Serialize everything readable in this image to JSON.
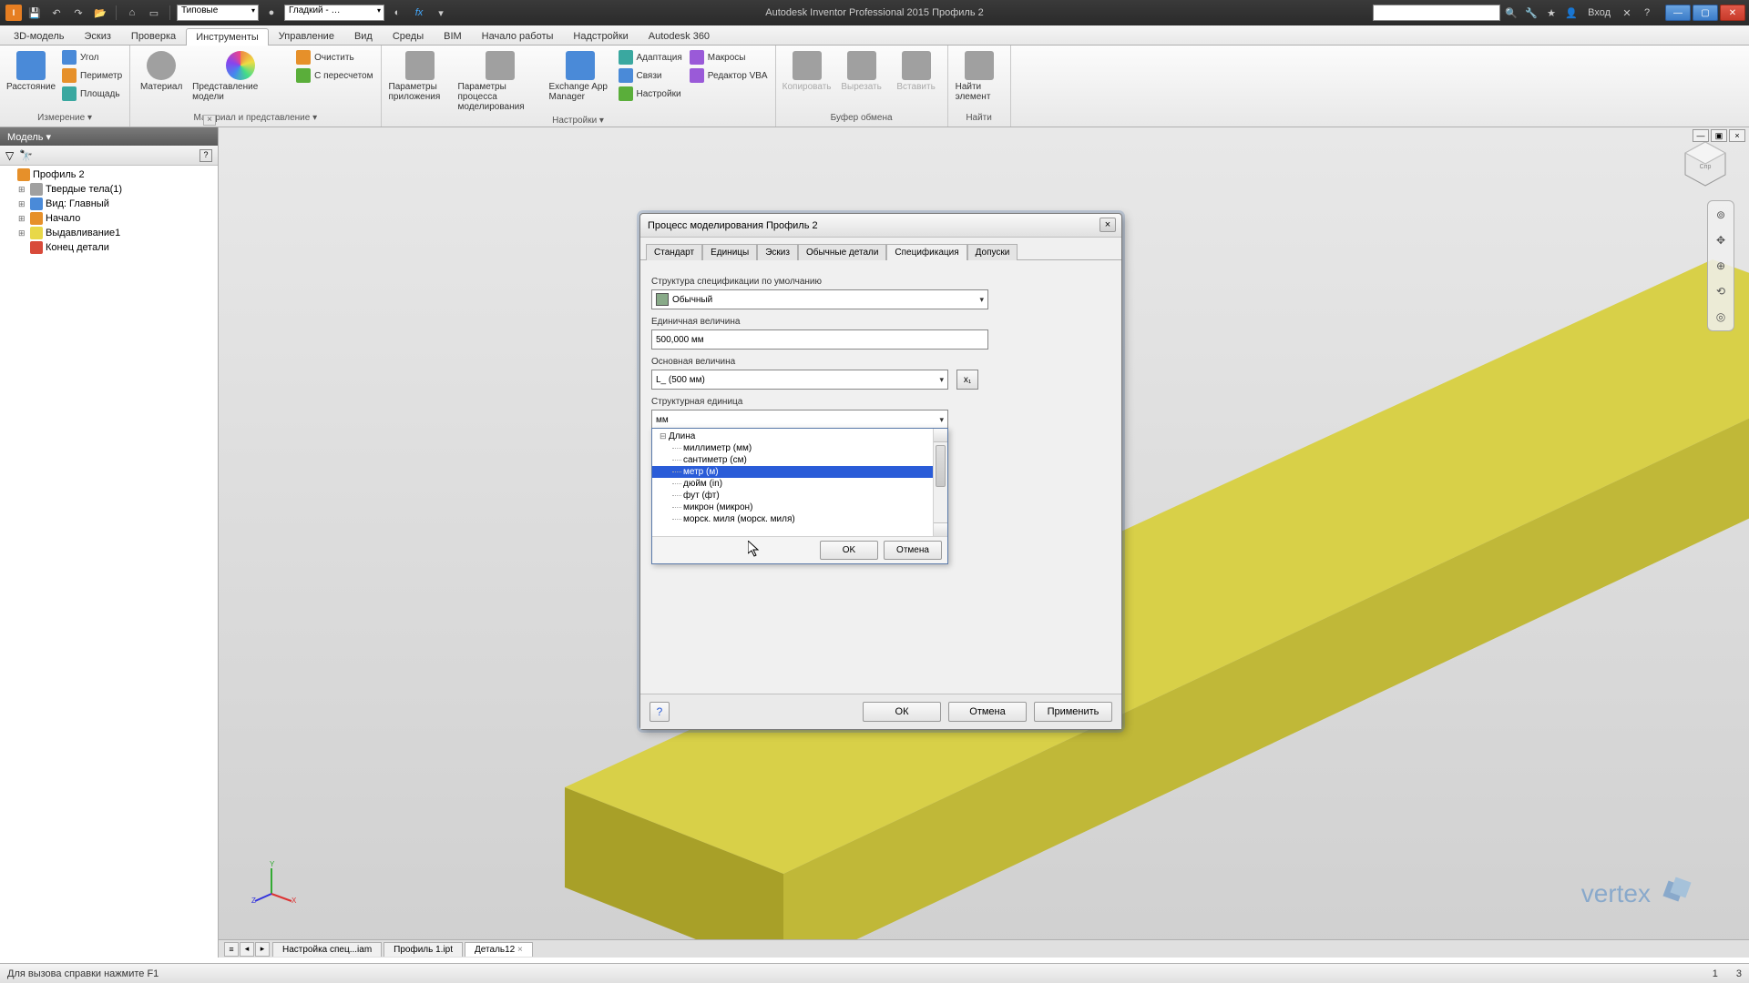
{
  "app": {
    "title_center": "Autodesk Inventor Professional 2015   Профиль 2",
    "login_label": "Вход"
  },
  "qat": {
    "combo1": "Типовые",
    "combo2": "Гладкий - …"
  },
  "ribbon_tabs": [
    "3D-модель",
    "Эскиз",
    "Проверка",
    "Инструменты",
    "Управление",
    "Вид",
    "Среды",
    "BIM",
    "Начало работы",
    "Надстройки",
    "Autodesk 360"
  ],
  "ribbon_active": 3,
  "ribbon_groups": {
    "g1": {
      "label": "Измерение ▾",
      "big": "Расстояние",
      "items": [
        "Угол",
        "Периметр",
        "Площадь"
      ]
    },
    "g2": {
      "label": "Материал и представление ▾",
      "b1": "Материал",
      "b2": "Представление модели",
      "items": [
        "Очистить",
        "С пересчетом"
      ]
    },
    "g3": {
      "label": "Настройки ▾",
      "b1": "Параметры приложения",
      "b2": "Параметры процесса моделирования",
      "b3": "Exchange App Manager",
      "items": [
        "Адаптация",
        "Связи",
        "Настройки",
        "Макросы",
        "Редактор VBA"
      ]
    },
    "g4": {
      "label": "Буфер обмена",
      "b1": "Копировать",
      "b2": "Вырезать",
      "b3": "Вставить"
    },
    "g5": {
      "label": "Найти",
      "b1": "Найти элемент"
    }
  },
  "browser": {
    "title": "Модель ▾",
    "tree": [
      {
        "label": "Профиль 2",
        "icon": "ic-orange",
        "level": 1,
        "exp": ""
      },
      {
        "label": "Твердые тела(1)",
        "icon": "ic-gray",
        "level": 2,
        "exp": "⊞"
      },
      {
        "label": "Вид: Главный",
        "icon": "ic-blue",
        "level": 2,
        "exp": "⊞"
      },
      {
        "label": "Начало",
        "icon": "ic-orange",
        "level": 2,
        "exp": "⊞"
      },
      {
        "label": "Выдавливание1",
        "icon": "ic-yellow",
        "level": 2,
        "exp": "⊞"
      },
      {
        "label": "Конец детали",
        "icon": "ic-red",
        "level": 2,
        "exp": ""
      }
    ]
  },
  "dialog": {
    "title": "Процесс моделирования Профиль 2",
    "tabs": [
      "Стандарт",
      "Единицы",
      "Эскиз",
      "Обычные детали",
      "Спецификация",
      "Допуски"
    ],
    "active_tab": 4,
    "fld1_label": "Структура спецификации по умолчанию",
    "fld1_value": "Обычный",
    "fld2_label": "Единичная величина",
    "fld2_value": "500,000 мм",
    "fld3_label": "Основная величина",
    "fld3_value": "L_ (500 мм)",
    "fld4_label": "Структурная единица",
    "fld4_value": "мм",
    "dropdown": {
      "root": "Длина",
      "items": [
        "миллиметр (мм)",
        "сантиметр (см)",
        "метр (м)",
        "дюйм (in)",
        "фут (фт)",
        "микрон (микрон)",
        "морск. миля (морск. миля)"
      ],
      "selected_index": 2,
      "ok": "OK",
      "cancel": "Отмена"
    },
    "ok": "ОК",
    "cancel": "Отмена",
    "apply": "Применить"
  },
  "doc_tabs": [
    "Настройка спец...iam",
    "Профиль 1.ipt",
    "Деталь12"
  ],
  "doc_active": 2,
  "status": {
    "left": "Для вызова справки нажмите F1",
    "r1": "1",
    "r2": "3"
  },
  "watermark": "vertex"
}
